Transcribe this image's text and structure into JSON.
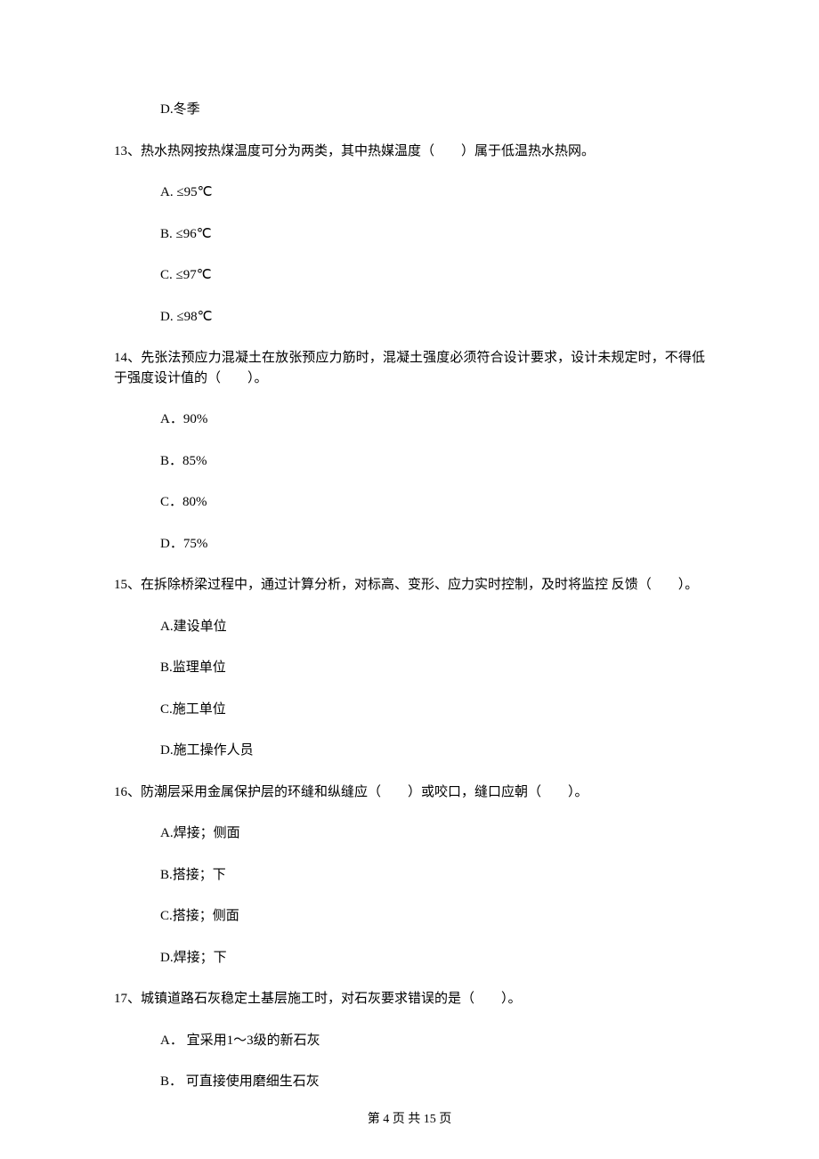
{
  "orphan_option": "D.冬季",
  "questions": [
    {
      "num": "13、",
      "text": "热水热网按热煤温度可分为两类，其中热媒温度（　　）属于低温热水热网。",
      "options": [
        "A.  ≤95℃",
        "B.  ≤96℃",
        "C.  ≤97℃",
        "D.  ≤98℃"
      ]
    },
    {
      "num": "14、",
      "text": "先张法预应力混凝土在放张预应力筋时，混凝土强度必须符合设计要求，设计未规定时，不得低于强度设计值的（　　）。",
      "options": [
        "A．90%",
        "B．85%",
        "C．80%",
        "D．75%"
      ]
    },
    {
      "num": "15、",
      "text": "在拆除桥梁过程中，通过计算分析，对标高、变形、应力实时控制，及时将监控 反馈（　　）。",
      "options": [
        "A.建设单位",
        "B.监理单位",
        "C.施工单位",
        "D.施工操作人员"
      ]
    },
    {
      "num": "16、",
      "text": "防潮层采用金属保护层的环缝和纵缝应（　　）或咬口，缝口应朝（　　）。",
      "options": [
        "A.焊接；侧面",
        "B.搭接；下",
        "C.搭接；侧面",
        "D.焊接；下"
      ]
    },
    {
      "num": "17、",
      "text": "城镇道路石灰稳定土基层施工时，对石灰要求错误的是（　　）。",
      "options": [
        "A． 宜采用1～3级的新石灰",
        "B． 可直接使用磨细生石灰"
      ]
    }
  ],
  "footer": "第 4 页 共 15 页"
}
